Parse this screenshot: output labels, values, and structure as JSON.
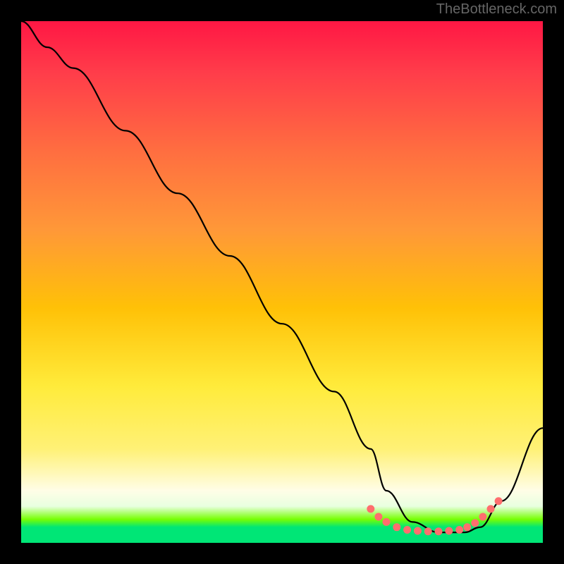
{
  "watermark": "TheBottleneck.com",
  "chart_data": {
    "type": "line",
    "title": "",
    "xlabel": "",
    "ylabel": "",
    "xlim": [
      0,
      100
    ],
    "ylim": [
      0,
      100
    ],
    "series": [
      {
        "name": "bottleneck-curve",
        "x": [
          0,
          5,
          10,
          20,
          30,
          40,
          50,
          60,
          67,
          70,
          75,
          80,
          85,
          88,
          92,
          100
        ],
        "values": [
          100,
          95,
          91,
          79,
          67,
          55,
          42,
          29,
          18,
          10,
          4,
          2,
          2,
          3,
          8,
          22
        ]
      }
    ],
    "markers": {
      "name": "optimal-range-dots",
      "x": [
        67,
        68.5,
        70,
        72,
        74,
        76,
        78,
        80,
        82,
        84,
        85.5,
        87,
        88.5,
        90,
        91.5
      ],
      "values": [
        6.5,
        5,
        4,
        3,
        2.5,
        2.3,
        2.2,
        2.2,
        2.3,
        2.5,
        3,
        3.8,
        5,
        6.5,
        8
      ]
    },
    "gradient_stops": [
      {
        "pct": 0,
        "color": "#ff1744"
      },
      {
        "pct": 10,
        "color": "#ff3d4a"
      },
      {
        "pct": 25,
        "color": "#ff6e40"
      },
      {
        "pct": 40,
        "color": "#ff9838"
      },
      {
        "pct": 55,
        "color": "#ffc107"
      },
      {
        "pct": 70,
        "color": "#ffeb3b"
      },
      {
        "pct": 82,
        "color": "#fff176"
      },
      {
        "pct": 90,
        "color": "#fffde7"
      },
      {
        "pct": 93,
        "color": "#e8ffe0"
      },
      {
        "pct": 95.5,
        "color": "#76ff03"
      },
      {
        "pct": 97,
        "color": "#00e676"
      },
      {
        "pct": 100,
        "color": "#00e676"
      }
    ]
  }
}
